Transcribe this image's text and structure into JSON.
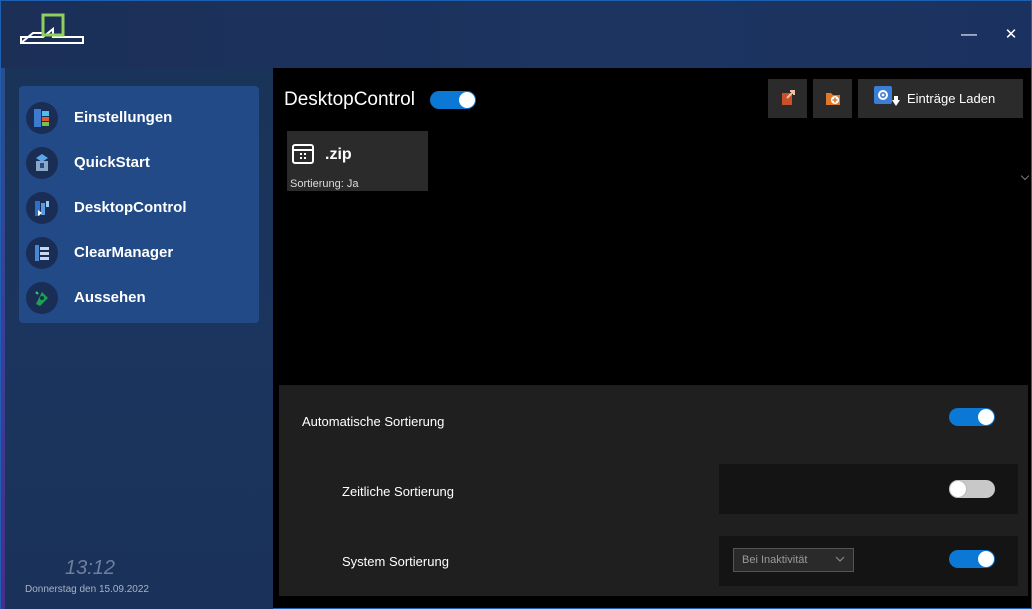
{
  "window": {
    "minimize_glyph": "—",
    "close_glyph": "✕"
  },
  "sidebar": {
    "items": [
      {
        "label": "Einstellungen",
        "icon": "settings-app-icon"
      },
      {
        "label": "QuickStart",
        "icon": "quickstart-icon"
      },
      {
        "label": "DesktopControl",
        "icon": "desktop-control-icon"
      },
      {
        "label": "ClearManager",
        "icon": "clear-manager-icon"
      },
      {
        "label": "Aussehen",
        "icon": "appearance-icon"
      }
    ],
    "time": "13:12",
    "date": "Donnerstag den 15.09.2022"
  },
  "main": {
    "title": "DesktopControl",
    "title_toggle_on": true,
    "toolbar": {
      "load_label": "Einträge Laden"
    },
    "entries": [
      {
        "name": ".zip",
        "subtitle": "Sortierung: Ja"
      }
    ]
  },
  "settings": {
    "auto_sort": {
      "label": "Automatische Sortierung",
      "on": true
    },
    "time_sort": {
      "label": "Zeitliche Sortierung",
      "on": false
    },
    "system_sort": {
      "label": "System Sortierung",
      "on": true,
      "select_value": "Bei Inaktivität"
    }
  },
  "colors": {
    "accent": "#0a78d4",
    "titlebar": "#1d3461",
    "sidebar": "#1b355e",
    "nav_panel": "#214a86",
    "panel": "#1f1f1f",
    "card": "#2b2b2b"
  }
}
